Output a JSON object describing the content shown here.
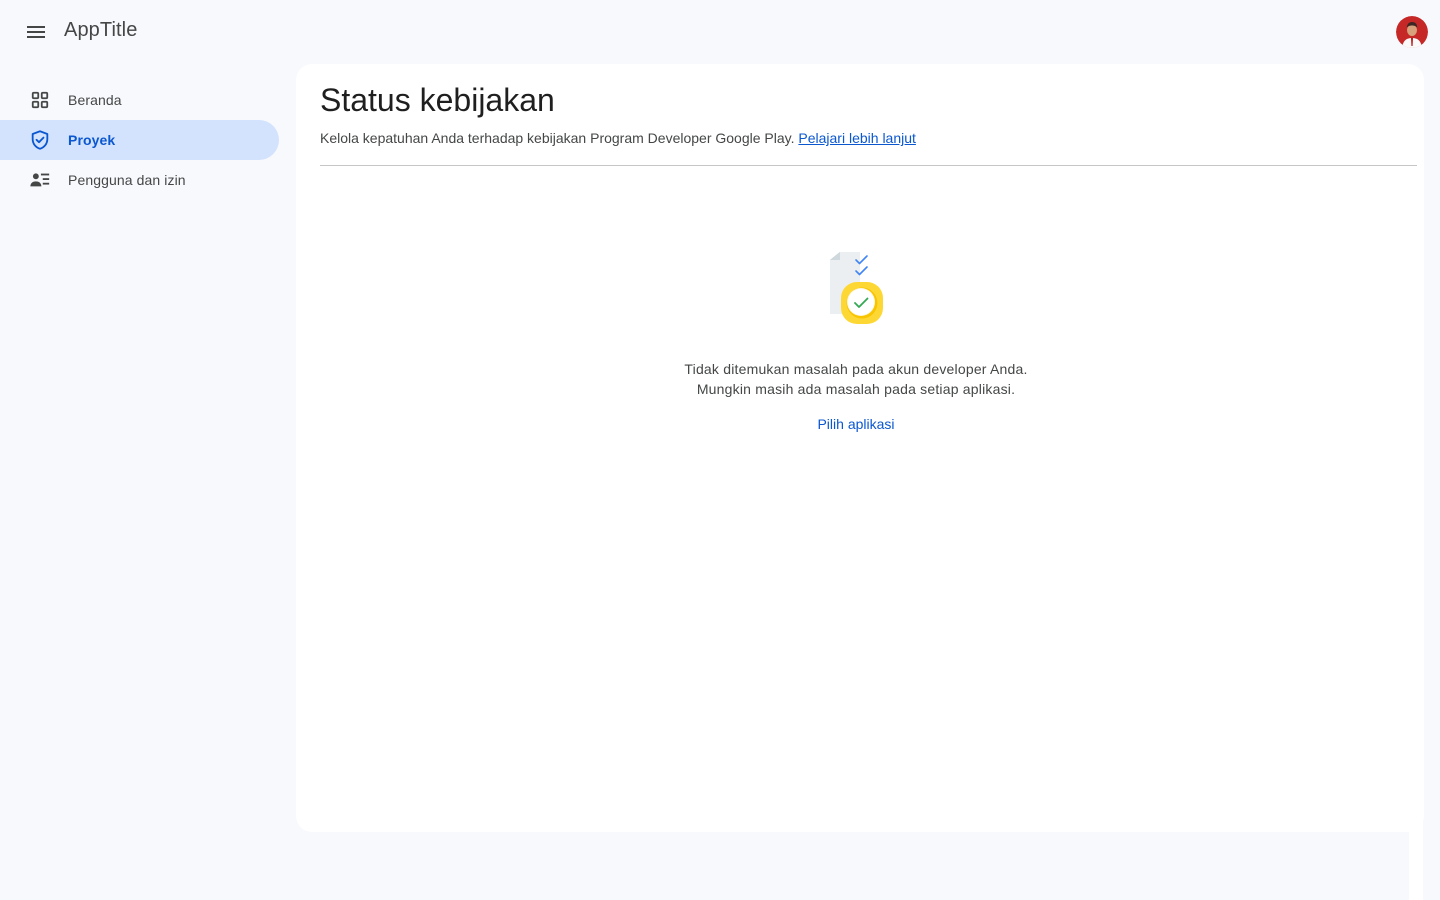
{
  "header": {
    "app_title": "AppTitle",
    "menu_icon": "menu-icon",
    "avatar_icon": "avatar-icon"
  },
  "sidebar": {
    "items": [
      {
        "label": "Beranda",
        "icon": "dashboard-icon",
        "active": false
      },
      {
        "label": "Proyek",
        "icon": "shield-check-icon",
        "active": true
      },
      {
        "label": "Pengguna dan izin",
        "icon": "manage-accounts-icon",
        "active": false
      }
    ]
  },
  "main": {
    "title": "Status kebijakan",
    "subtitle": "Kelola kepatuhan Anda terhadap kebijakan Program Developer Google Play.",
    "learn_more_link": "Pelajari lebih lanjut",
    "empty_state": {
      "line1": "Tidak ditemukan masalah pada akun developer Anda.",
      "line2": "Mungkin masih ada masalah pada setiap aplikasi.",
      "action_label": "Pilih aplikasi",
      "illustration": "policy-checklist-illustration"
    }
  },
  "colors": {
    "accent": "#0b57d0",
    "active_nav_bg": "#d3e3fd",
    "page_bg": "#f8f9fd",
    "card_bg": "#ffffff",
    "illustration_yellow": "#fdd835",
    "check_green": "#34a853"
  }
}
